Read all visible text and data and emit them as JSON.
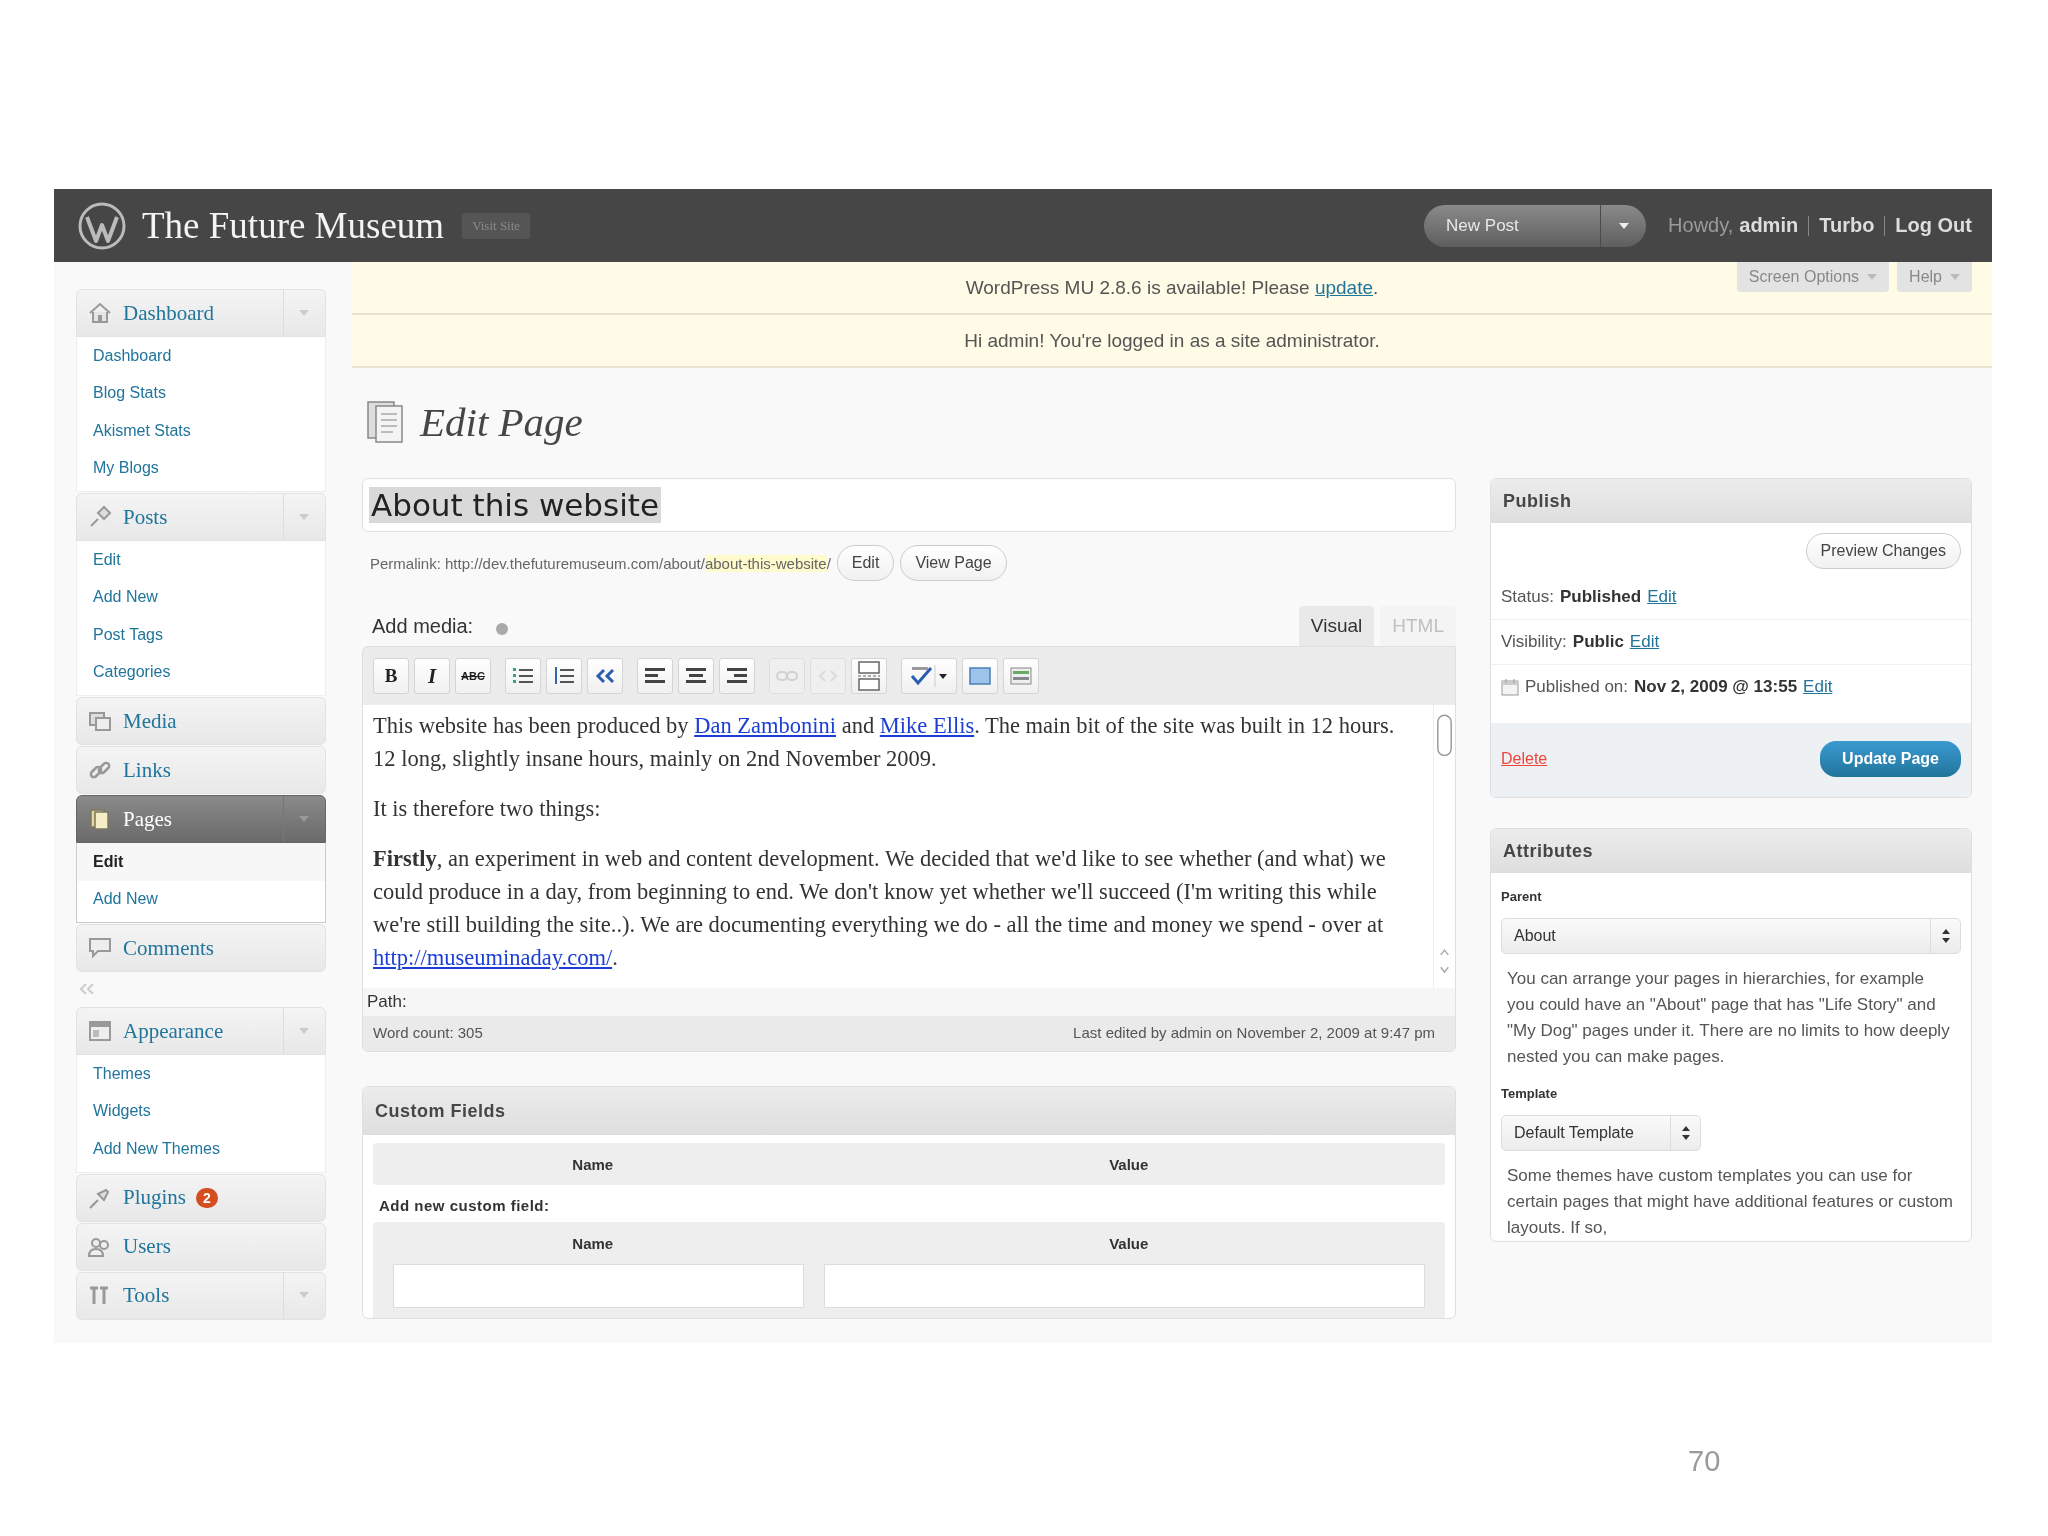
{
  "header": {
    "site_title": "The Future Museum",
    "visit_site": "Visit Site",
    "new_post": "New Post",
    "howdy": "Howdy,",
    "user": "admin",
    "links": [
      "Turbo",
      "Log Out"
    ]
  },
  "screen_meta": [
    "Screen Options",
    "Help"
  ],
  "notices": [
    [
      {
        "text": "WordPress MU 2.8.6 is available! Please "
      },
      {
        "link": "update"
      },
      {
        "text": "."
      }
    ],
    [
      {
        "text": "Hi admin! You're logged in as a site administrator."
      }
    ]
  ],
  "menu": {
    "sections": [
      {
        "items": [
          {
            "label": "Dashboard",
            "toggle": true,
            "expanded": true,
            "selected": false,
            "children": [
              {
                "label": "Dashboard",
                "selected": false
              },
              {
                "label": "Blog Stats",
                "selected": false
              },
              {
                "label": "Akismet Stats",
                "selected": false
              },
              {
                "label": "My Blogs",
                "selected": false
              }
            ]
          },
          {
            "label": "Posts",
            "toggle": true,
            "expanded": true,
            "selected": false,
            "children": [
              {
                "label": "Edit",
                "selected": false
              },
              {
                "label": "Add New",
                "selected": false
              },
              {
                "label": "Post Tags",
                "selected": false
              },
              {
                "label": "Categories",
                "selected": false
              }
            ]
          },
          {
            "label": "Media",
            "toggle": false,
            "expanded": false,
            "selected": false
          },
          {
            "label": "Links",
            "toggle": false,
            "expanded": false,
            "selected": false
          },
          {
            "label": "Pages",
            "toggle": true,
            "expanded": true,
            "selected": true,
            "children": [
              {
                "label": "Edit",
                "selected": true
              },
              {
                "label": "Add New",
                "selected": false
              }
            ]
          },
          {
            "label": "Comments",
            "toggle": false,
            "expanded": false,
            "selected": false
          }
        ]
      },
      {
        "items": [
          {
            "label": "Appearance",
            "toggle": true,
            "expanded": true,
            "selected": false,
            "children": [
              {
                "label": "Themes",
                "selected": false
              },
              {
                "label": "Widgets",
                "selected": false
              },
              {
                "label": "Add New Themes",
                "selected": false
              }
            ]
          },
          {
            "label": "Plugins",
            "toggle": false,
            "expanded": false,
            "selected": false,
            "badge": "2"
          },
          {
            "label": "Users",
            "toggle": false,
            "expanded": false,
            "selected": false
          },
          {
            "label": "Tools",
            "toggle": true,
            "expanded": false,
            "selected": false
          }
        ]
      }
    ]
  },
  "page_heading": "Edit Page",
  "title_field": {
    "value": "About this website"
  },
  "permalink": {
    "label": "Permalink:",
    "base": "http://dev.thefuturemuseum.com/about/",
    "slug": "about-this-website",
    "trail": "/",
    "buttons": [
      "Edit",
      "View Page"
    ]
  },
  "editor": {
    "add_media": "Add media:",
    "tabs": [
      {
        "label": "Visual",
        "selected": true
      },
      {
        "label": "HTML",
        "selected": false
      }
    ],
    "toolbar": [
      [
        {
          "kind": "bold",
          "label": "B",
          "disabled": false
        },
        {
          "kind": "italic",
          "label": "I",
          "disabled": false
        },
        {
          "kind": "strikethrough",
          "label": "ABC",
          "disabled": false
        }
      ],
      [
        {
          "kind": "bullet-list",
          "disabled": false
        },
        {
          "kind": "numbered-list",
          "disabled": false
        },
        {
          "kind": "blockquote",
          "disabled": false
        }
      ],
      [
        {
          "kind": "align-left",
          "disabled": false
        },
        {
          "kind": "align-center",
          "disabled": false
        },
        {
          "kind": "align-right",
          "disabled": false
        }
      ],
      [
        {
          "kind": "link",
          "disabled": true
        },
        {
          "kind": "unlink",
          "disabled": true
        },
        {
          "kind": "more",
          "disabled": false
        }
      ],
      [
        {
          "kind": "spellcheck",
          "disabled": false
        },
        {
          "kind": "fullscreen",
          "disabled": false
        },
        {
          "kind": "kitchen-sink",
          "disabled": false
        }
      ]
    ],
    "paragraphs": [
      [
        {
          "text": "This website has been produced by "
        },
        {
          "link": "Dan Zambonini"
        },
        {
          "text": " and "
        },
        {
          "link": "Mike Ellis"
        },
        {
          "text": ". The main bit of the site was built in 12 hours. 12 long, slightly insane hours, mainly on 2nd November 2009."
        }
      ],
      [
        {
          "text": "It is therefore two things:"
        }
      ],
      [
        {
          "text": "**Firstly**, an experiment in web and content development. We decided that we'd like to see whether (and what) we could produce in a day, from beginning to end. We don't know yet whether we'll succeed (I'm writing this while we're still building the site..). We are documenting everything we do - all the time and money we spend - over at "
        },
        {
          "link": "http://museuminaday.com/"
        },
        {
          "text": "."
        }
      ]
    ],
    "path_label": "Path:",
    "word_count": "Word count: 305",
    "last_edited": "Last edited by admin on November 2, 2009 at 9:47 pm"
  },
  "custom_fields": {
    "title": "Custom Fields",
    "columns": [
      "Name",
      "Value"
    ],
    "add_new": "Add new custom field:",
    "new_columns": [
      "Name",
      "Value"
    ]
  },
  "publish": {
    "title": "Publish",
    "preview": "Preview Changes",
    "rows": [
      {
        "kind": "status",
        "label": "Status:",
        "value": "Published",
        "link": "Edit"
      },
      {
        "kind": "visibility",
        "label": "Visibility:",
        "value": "Public",
        "link": "Edit"
      },
      {
        "kind": "date",
        "label": "Published on:",
        "value": "Nov 2, 2009 @ 13:55",
        "link": "Edit"
      }
    ],
    "delete": "Delete",
    "update": "Update Page"
  },
  "attributes": {
    "title": "Attributes",
    "parent_label": "Parent",
    "parent_value": "About",
    "parent_help": "You can arrange your pages in hierarchies, for example you could have an \"About\" page that has \"Life Story\" and \"My Dog\" pages under it. There are no limits to how deeply nested you can make pages.",
    "template_label": "Template",
    "template_value": "Default Template",
    "template_help": "Some themes have custom templates you can use for certain pages that might have additional features or custom layouts. If so,"
  },
  "slide": {
    "page_number": "70"
  }
}
